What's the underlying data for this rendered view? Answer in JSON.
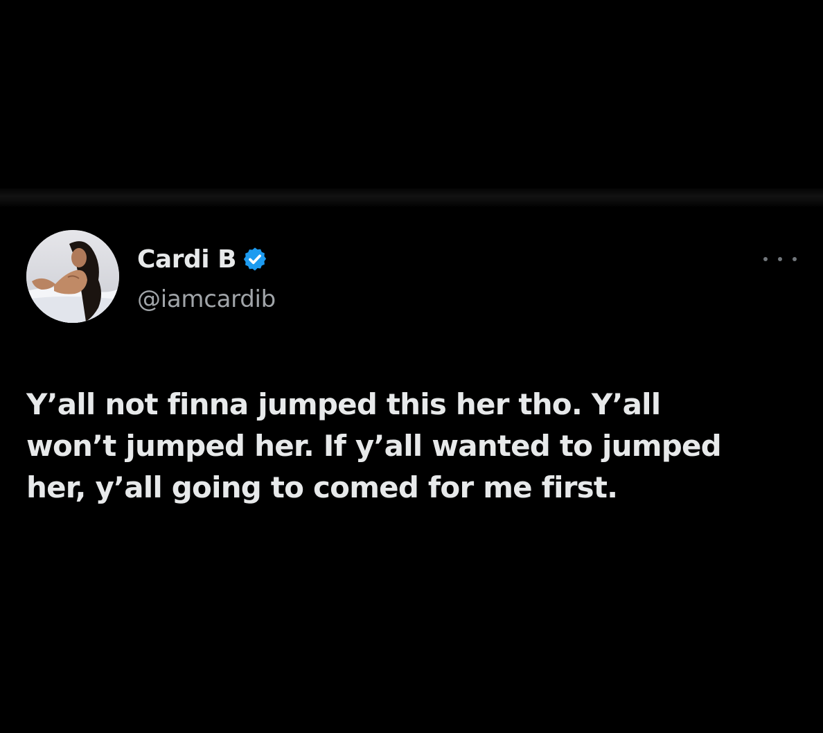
{
  "tweet": {
    "author": {
      "display_name": "Cardi B",
      "handle": "@iamcardib",
      "verified": true,
      "verified_icon": "verified-badge-icon",
      "avatar_icon": "profile-photo"
    },
    "text_lines": [
      "Y’all not finna jumped this her tho. Y’all",
      "won’t jumped her. If y’all wanted to jumped",
      "her, y’all going to comed for me first."
    ],
    "more_icon": "more-options-icon"
  },
  "colors": {
    "background": "#000000",
    "primary_text": "#e7e9ea",
    "secondary_text": "#a1a5a9",
    "verified_blue": "#1d9bf0"
  }
}
